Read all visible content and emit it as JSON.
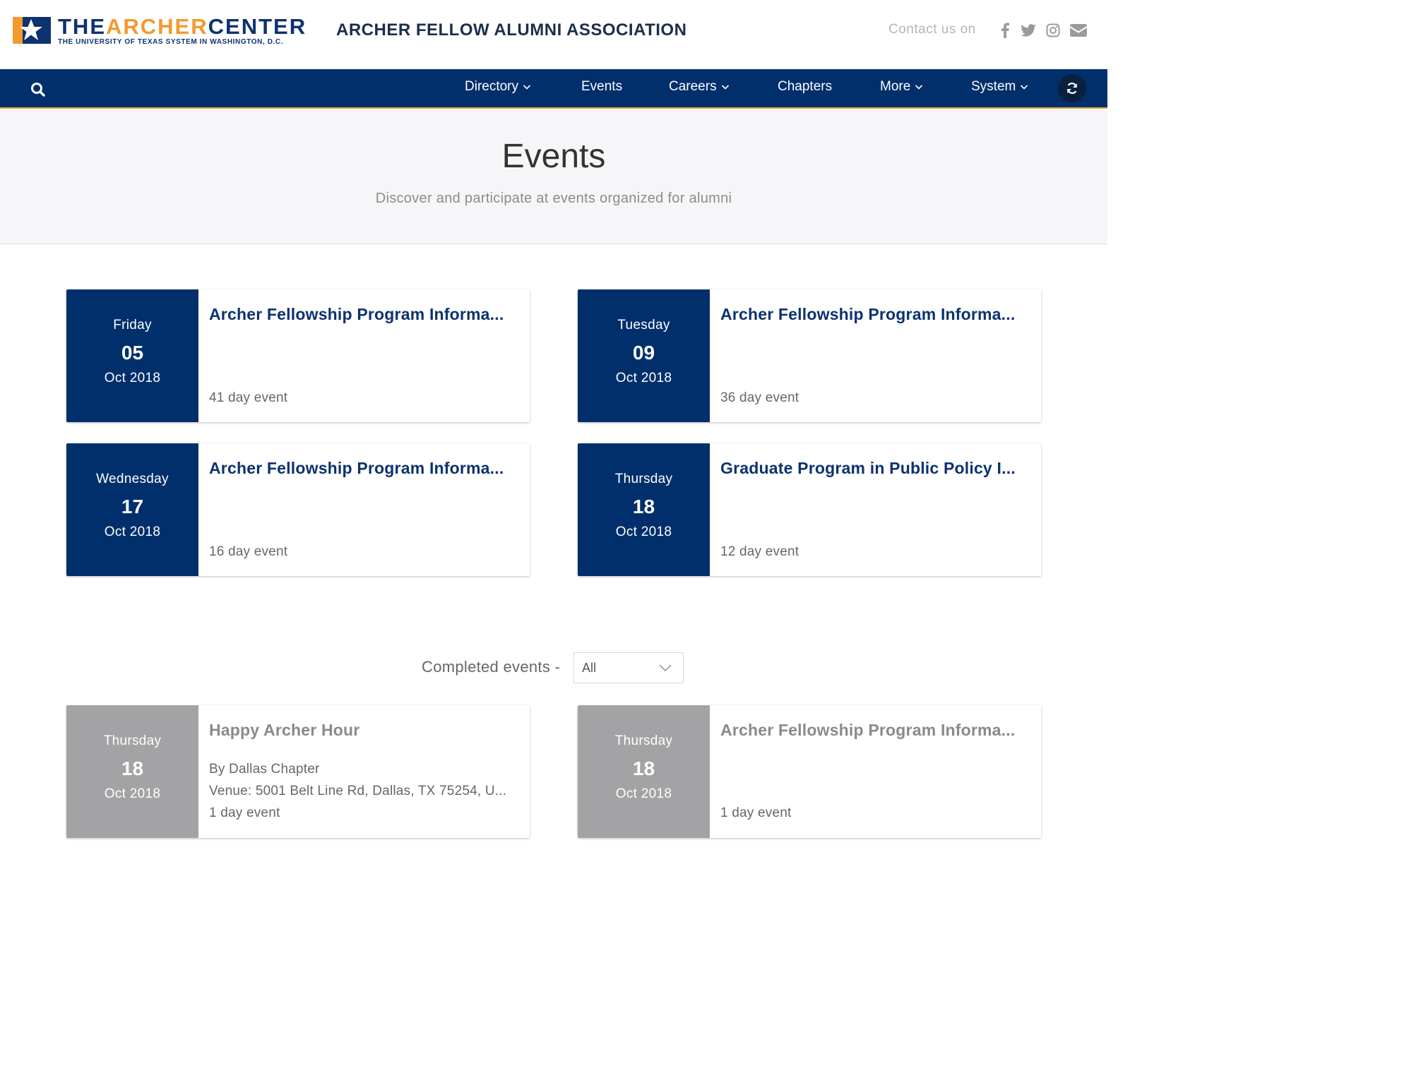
{
  "brand": {
    "logo_prefix": "THE",
    "logo_orange": "ARCHER",
    "logo_suffix": "CENTER",
    "logo_subtitle": "THE UNIVERSITY OF TEXAS SYSTEM IN WASHINGTON, D.C.",
    "association": "ARCHER FELLOW ALUMNI ASSOCIATION"
  },
  "contact": {
    "label": "Contact us on",
    "icons": [
      "facebook-icon",
      "twitter-icon",
      "instagram-icon",
      "email-icon"
    ]
  },
  "nav": {
    "items": [
      {
        "label": "Directory",
        "dropdown": true
      },
      {
        "label": "Events",
        "dropdown": false
      },
      {
        "label": "Careers",
        "dropdown": true
      },
      {
        "label": "Chapters",
        "dropdown": false
      },
      {
        "label": "More",
        "dropdown": true
      },
      {
        "label": "System",
        "dropdown": true
      }
    ]
  },
  "hero": {
    "title": "Events",
    "subtitle": "Discover and participate at events organized for alumni"
  },
  "upcoming": [
    {
      "weekday": "Friday",
      "day": "05",
      "month": "Oct 2018",
      "title": "Archer Fellowship Program Informa...",
      "duration": "41 day event"
    },
    {
      "weekday": "Tuesday",
      "day": "09",
      "month": "Oct 2018",
      "title": "Archer Fellowship Program Informa...",
      "duration": "36 day event"
    },
    {
      "weekday": "Wednesday",
      "day": "17",
      "month": "Oct 2018",
      "title": "Archer Fellowship Program Informa...",
      "duration": "16 day event"
    },
    {
      "weekday": "Thursday",
      "day": "18",
      "month": "Oct 2018",
      "title": "Graduate Program in Public Policy I...",
      "duration": "12 day event"
    }
  ],
  "completed": {
    "label": "Completed events -",
    "filter_value": "All",
    "events": [
      {
        "weekday": "Thursday",
        "day": "18",
        "month": "Oct 2018",
        "title": "Happy Archer Hour",
        "organizer": "By Dallas Chapter",
        "venue": "Venue: 5001 Belt Line Rd, Dallas, TX 75254, U...",
        "duration": "1 day event"
      },
      {
        "weekday": "Thursday",
        "day": "18",
        "month": "Oct 2018",
        "title": "Archer Fellowship Program Informa...",
        "duration": "1 day event"
      }
    ]
  },
  "colors": {
    "navy": "#002f6c",
    "orange": "#f29a2e",
    "past_gray": "#a3a3a6"
  }
}
